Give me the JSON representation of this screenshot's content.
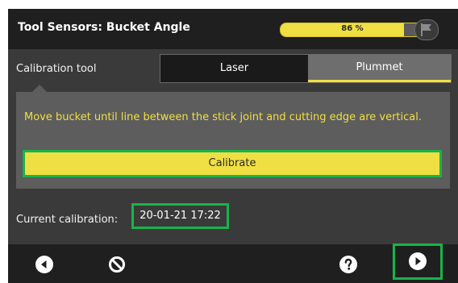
{
  "header": {
    "title": "Tool Sensors: Bucket Angle",
    "battery_label": "86 %",
    "battery_fraction": 0.86,
    "flag_icon": "flag-icon"
  },
  "calibration_tool": {
    "label": "Calibration tool",
    "options": [
      "Laser",
      "Plummet"
    ],
    "selected": "Plummet"
  },
  "instruction": {
    "text": "Move bucket until line between the stick joint and cutting edge are vertical.",
    "calibrate_label": "Calibrate"
  },
  "current_calibration": {
    "label": "Current calibration:",
    "value": "20-01-21 17:22"
  },
  "footer": {
    "back_icon": "back-arrow-icon",
    "cancel_icon": "cancel-icon",
    "help_icon": "help-icon",
    "next_icon": "next-arrow-icon"
  },
  "colors": {
    "accent_yellow": "#f0df42",
    "highlight_green": "#19b34a",
    "background": "#3a3a3a",
    "bar_background": "#1f1f1f"
  }
}
